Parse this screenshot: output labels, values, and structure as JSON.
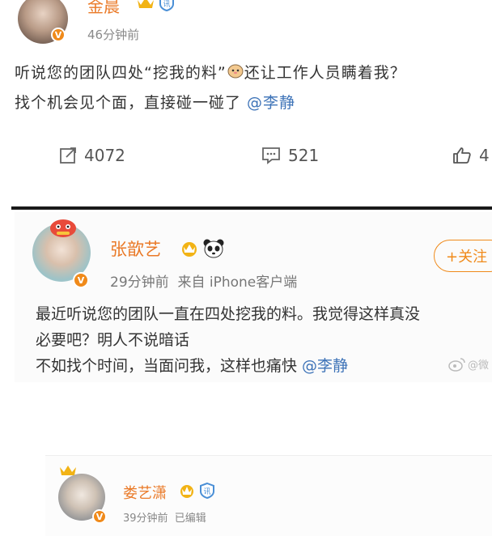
{
  "post1": {
    "name": "金晨",
    "time": "46分钟前",
    "line1_a": "听说您的团队四处“挖我的料”",
    "line1_b": "还让工作人员瞒着我？",
    "line2_text": "找个机会见个面，直接碰一碰了 ",
    "mention": "@李静",
    "repost_count": "4072",
    "comment_count": "521",
    "like_count": "4"
  },
  "post2": {
    "name": "张歆艺",
    "time_source": "29分钟前  来自 iPhone客户端",
    "follow_label": "+关注",
    "line1": "最近听说您的团队一直在四处挖我的料。我觉得这样真没",
    "line2": "必要吧？明人不说暗话",
    "line3_text": "不如找个时间，当面问我，这样也痛快 ",
    "mention": "@李静",
    "watermark": "@微"
  },
  "post3": {
    "name": "娄艺潇",
    "time": "39分钟前  已编辑"
  },
  "colors": {
    "name_orange": "#ea7a28",
    "mention_blue": "#3f74b8",
    "vip_gold": "#f2b315",
    "verified_orange": "#f08a1a"
  }
}
